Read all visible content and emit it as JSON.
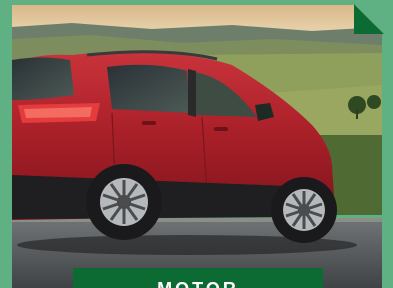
{
  "card": {
    "label": "MOTOR"
  },
  "photo": {
    "subject": "red-crossover-suv"
  },
  "colors": {
    "frame": "#5fb183",
    "label_bg": "#0b6b33",
    "label_text": "#ffffff",
    "car": "#b0242c"
  }
}
